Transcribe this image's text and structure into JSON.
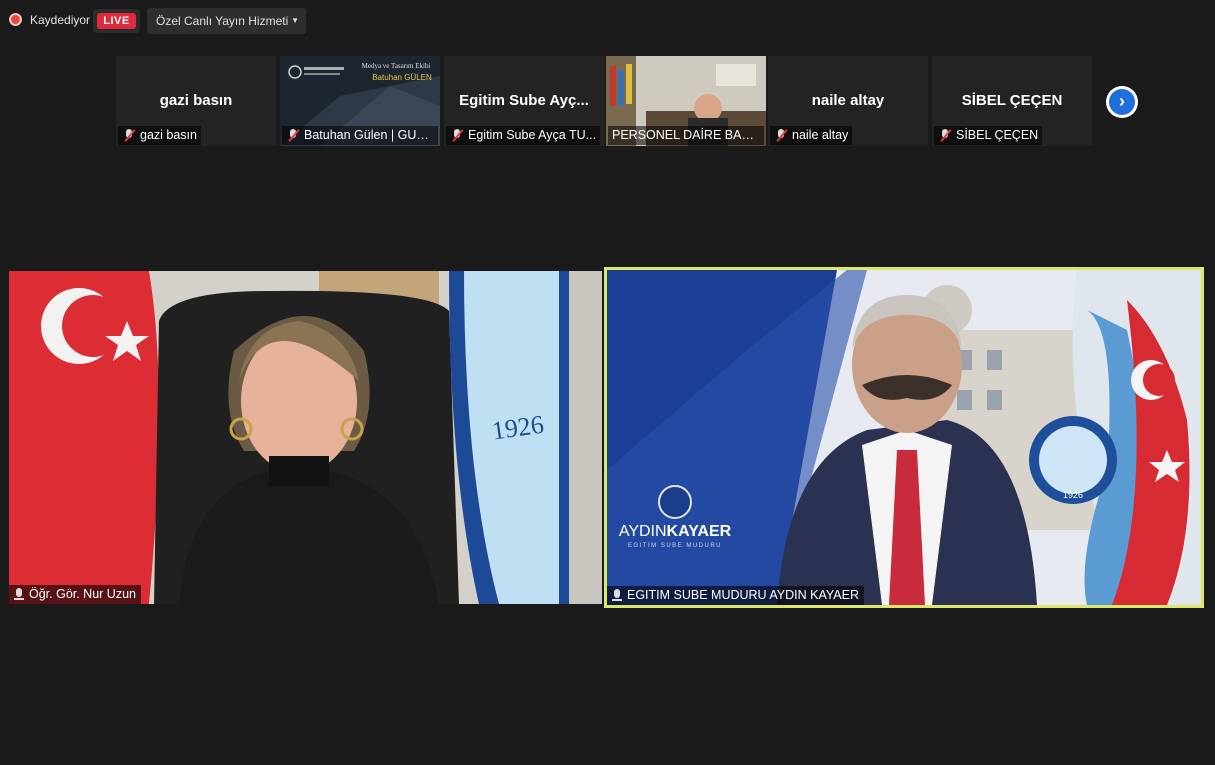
{
  "toolbar": {
    "recording_label": "Kaydediyor",
    "live_label": "LIVE",
    "stream_service": "Özel Canlı Yayın Hizmeti"
  },
  "strip": {
    "tiles": [
      {
        "display": "gazi basın",
        "label": "gazi basın"
      },
      {
        "display": "",
        "label": "Batuhan Gülen | GUZE...",
        "thumb_title": "Medya ve Tasarım Ekibi",
        "thumb_name": "Batuhan GÜLEN"
      },
      {
        "display": "Egitim  Sube  Ayç...",
        "label": "Egitim Sube Ayça TU..."
      },
      {
        "display": "",
        "label": "PERSONEL DAİRE BAŞKA..."
      },
      {
        "display": "naile altay",
        "label": "naile altay"
      },
      {
        "display": "SİBEL ÇEÇEN",
        "label": "SİBEL ÇEÇEN"
      }
    ],
    "next_icon": "›"
  },
  "main": {
    "left": {
      "label": "Öğr. Gör. Nur Uzun",
      "year": "1926"
    },
    "right": {
      "label": "EGITIM SUBE MUDURU AYDIN KAYAER",
      "brand_first": "AYDIN",
      "brand_last": "KAYAER",
      "brand_sub": "EGITIM SUBE MUDURU",
      "year": "1926",
      "seal_text": "GAZİ ÜNİVERSİTESİ"
    }
  },
  "colors": {
    "live": "#e02a3c",
    "active_border": "#dce86a",
    "next_button": "#1e6fdc"
  }
}
